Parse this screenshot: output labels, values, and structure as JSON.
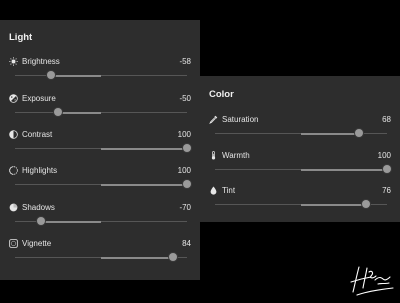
{
  "light": {
    "title": "Light",
    "items": [
      {
        "label": "Brightness",
        "value": "-58",
        "icon": "brightness-icon",
        "level": -0.58
      },
      {
        "label": "Exposure",
        "value": "-50",
        "icon": "exposure-icon",
        "level": -0.5
      },
      {
        "label": "Contrast",
        "value": "100",
        "icon": "contrast-icon",
        "level": 1.0
      },
      {
        "label": "Highlights",
        "value": "100",
        "icon": "highlights-icon",
        "level": 1.0
      },
      {
        "label": "Shadows",
        "value": "-70",
        "icon": "shadows-icon",
        "level": -0.7
      },
      {
        "label": "Vignette",
        "value": "84",
        "icon": "vignette-icon",
        "level": 0.84
      }
    ]
  },
  "color": {
    "title": "Color",
    "items": [
      {
        "label": "Saturation",
        "value": "68",
        "icon": "saturation-icon",
        "level": 0.68
      },
      {
        "label": "Warmth",
        "value": "100",
        "icon": "warmth-icon",
        "level": 1.0
      },
      {
        "label": "Tint",
        "value": "76",
        "icon": "tint-icon",
        "level": 0.76
      }
    ]
  },
  "colors": {
    "background": "#000000",
    "panel": "#2d2d2d",
    "text": "#e6e6e6",
    "track": "#565656",
    "track_fill": "#8a8a8a",
    "thumb": "#9a9a9a"
  },
  "signature": {
    "text": "Halfa Hozan",
    "icon": "signature-watermark"
  }
}
